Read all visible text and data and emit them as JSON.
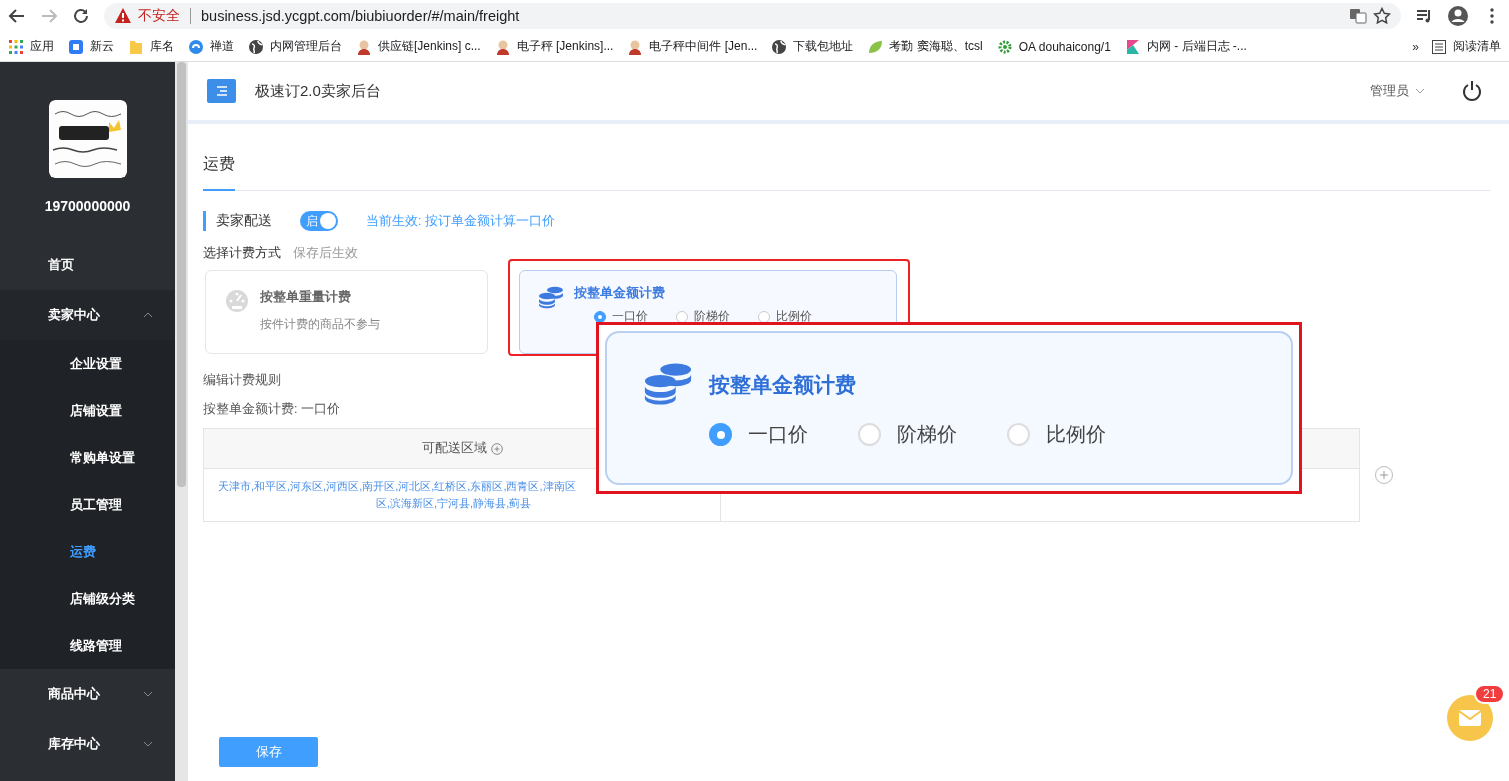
{
  "browser": {
    "insecure_label": "不安全",
    "url": "business.jsd.ycgpt.com/biubiuorder/#/main/freight",
    "bookmarks": [
      {
        "label": "应用",
        "kind": "apps"
      },
      {
        "label": "新云",
        "kind": "app"
      },
      {
        "label": "库名",
        "kind": "folder"
      },
      {
        "label": "禅道",
        "kind": "swirl"
      },
      {
        "label": "内网管理后台",
        "kind": "globe"
      },
      {
        "label": "供应链[Jenkins]  c...",
        "kind": "person"
      },
      {
        "label": "电子秤  [Jenkins]...",
        "kind": "person"
      },
      {
        "label": "电子秤中间件 [Jen...",
        "kind": "person"
      },
      {
        "label": "下载包地址",
        "kind": "globe"
      },
      {
        "label": "考勤  窦海聪、tcsl",
        "kind": "leaf"
      },
      {
        "label": "OA  douhaicong/1",
        "kind": "gear"
      },
      {
        "label": "内网 - 后端日志 -...",
        "kind": "kibana"
      }
    ],
    "overflow": "»",
    "reading_list": "阅读清单"
  },
  "sidebar": {
    "account": "19700000000",
    "items": [
      {
        "label": "首页",
        "selected": false
      },
      {
        "label": "卖家中心",
        "expanded": true,
        "children": [
          {
            "label": "企业设置",
            "selected": false
          },
          {
            "label": "店铺设置",
            "selected": false
          },
          {
            "label": "常购单设置",
            "selected": false
          },
          {
            "label": "员工管理",
            "selected": false
          },
          {
            "label": "运费",
            "selected": true
          },
          {
            "label": "店铺级分类",
            "selected": false
          },
          {
            "label": "线路管理",
            "selected": false
          }
        ]
      },
      {
        "label": "商品中心",
        "expanded": false
      },
      {
        "label": "库存中心",
        "expanded": false
      }
    ]
  },
  "header": {
    "title": "极速订2.0卖家后台",
    "user": "管理员"
  },
  "tabs": [
    {
      "label": "运费",
      "selected": true
    }
  ],
  "delivery": {
    "label": "卖家配送",
    "toggle": {
      "on": true,
      "text": "启"
    },
    "current": "当前生效: 按订单金额计算一口价"
  },
  "method": {
    "label": "选择计费方式",
    "hint": "保存后生效",
    "options": [
      {
        "kind": "weight",
        "title": "按整单重量计费",
        "note": "按件计费的商品不参与",
        "selected": false,
        "highlighted": false
      },
      {
        "kind": "amount",
        "title": "按整单金额计费",
        "selected": true,
        "highlighted": true,
        "radios": [
          {
            "label": "一口价",
            "selected": true
          },
          {
            "label": "阶梯价",
            "selected": false
          },
          {
            "label": "比例价",
            "selected": false
          }
        ]
      }
    ]
  },
  "rules": {
    "label": "编辑计费规则",
    "current": "按整单金额计费: 一口价"
  },
  "table": {
    "columns": [
      "可配送区域"
    ],
    "rows": [
      {
        "lines": [
          "天津市,和平区,河东区,河西区,南开区,河北区,红桥区,东丽区,西青区,津南区",
          "区,滨海新区,宁河县,静海县,蓟县"
        ]
      }
    ]
  },
  "save": "保存",
  "chat": {
    "badge": "21"
  },
  "callout": {
    "title": "按整单金额计费",
    "radios": [
      {
        "label": "一口价",
        "selected": true
      },
      {
        "label": "阶梯价",
        "selected": false
      },
      {
        "label": "比例价",
        "selected": false
      }
    ]
  }
}
